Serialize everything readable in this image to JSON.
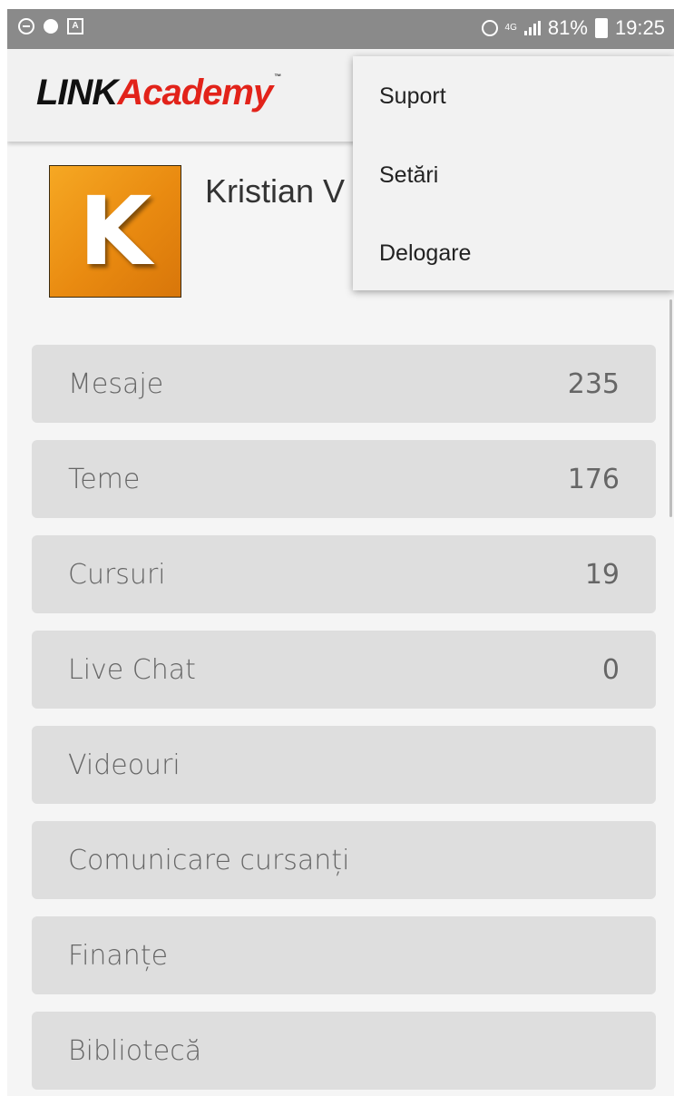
{
  "status_bar": {
    "battery": "81%",
    "time": "19:25",
    "network": "4G",
    "icons": [
      "do-not-disturb-icon",
      "sync-icon",
      "app-icon",
      "alarm-icon",
      "signal-icon",
      "battery-icon"
    ]
  },
  "app": {
    "logo_part1": "LINK",
    "logo_part2": "Academy",
    "logo_tm": "™"
  },
  "profile": {
    "avatar_letter": "K",
    "name": "Kristian V"
  },
  "menu": [
    {
      "label": "Mesaje",
      "count": "235"
    },
    {
      "label": "Teme",
      "count": "176"
    },
    {
      "label": "Cursuri",
      "count": "19"
    },
    {
      "label": "Live Chat",
      "count": "0"
    },
    {
      "label": "Videouri",
      "count": ""
    },
    {
      "label": "Comunicare cursanți",
      "count": ""
    },
    {
      "label": "Finanțe",
      "count": ""
    },
    {
      "label": "Bibliotecă",
      "count": ""
    }
  ],
  "dropdown": {
    "items": [
      "Suport",
      "Setări",
      "Delogare"
    ]
  },
  "colors": {
    "logo_accent": "#e2231a",
    "avatar": "#f09a18",
    "row_bg": "#dedede"
  }
}
